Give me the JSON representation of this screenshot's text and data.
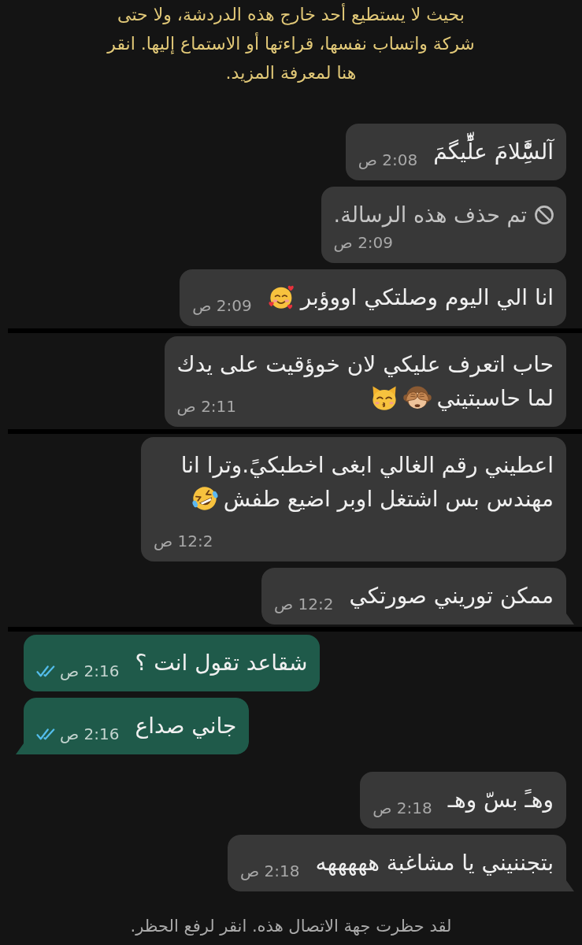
{
  "encryption_notice": {
    "text": "بحيث لا يستطيع أحد خارج هذه الدردشة، ولا حتى شركة واتساب نفسها، قراءتها أو الاستماع إليها. انقر هنا لمعرفة المزيد."
  },
  "messages": [
    {
      "kind": "text",
      "outgoing": false,
      "tail": false,
      "lines": [
        "آلسَِّْٰلامَ علِّْٰيگمَ"
      ],
      "time": "2:08 ص"
    },
    {
      "kind": "deleted",
      "outgoing": false,
      "tail": false,
      "lines": [
        "تم حذف هذه الرسالة."
      ],
      "time": "2:09 ص"
    },
    {
      "kind": "text",
      "outgoing": false,
      "tail": false,
      "lines": [
        "انا الي اليوم وصلتكي اووؤبر"
      ],
      "time": "2:09 ص"
    },
    {
      "kind": "divider"
    },
    {
      "kind": "text",
      "outgoing": false,
      "tail": false,
      "lines": [
        "حاب اتعرف عليكي لان خوؤقيت على يدك",
        "لما حاسبتيني"
      ],
      "time": "2:11 ص"
    },
    {
      "kind": "divider"
    },
    {
      "kind": "text",
      "outgoing": false,
      "tail": false,
      "lines": [
        "اعطيني رقم الغالي ابغى اخطبكيً.وترا انا",
        "مهندس بس اشتغل اوبر اضيع طفش"
      ],
      "time": "12:2 ص"
    },
    {
      "kind": "text",
      "outgoing": false,
      "tail": true,
      "lines": [
        "ممكن توريني صورتكي"
      ],
      "time": "12:2 ص"
    },
    {
      "kind": "divider"
    },
    {
      "kind": "text",
      "outgoing": true,
      "tail": false,
      "read": true,
      "lines": [
        "شقاعد تقول انت ؟"
      ],
      "time": "2:16 ص"
    },
    {
      "kind": "text",
      "outgoing": true,
      "tail": true,
      "read": true,
      "lines": [
        "جاني صداع"
      ],
      "time": "2:16 ص"
    },
    {
      "kind": "text",
      "outgoing": false,
      "tail": false,
      "lines": [
        "وهـً بسّ وهـ"
      ],
      "time": "2:18 ص"
    },
    {
      "kind": "text",
      "outgoing": false,
      "tail": true,
      "lines": [
        "بتجننيني يا مشاغبة هههههه"
      ],
      "time": "2:18 ص"
    }
  ],
  "blocked_notice": {
    "text": "لقد حظرت جهة الاتصال هذه. انقر لرفع الحظر."
  }
}
